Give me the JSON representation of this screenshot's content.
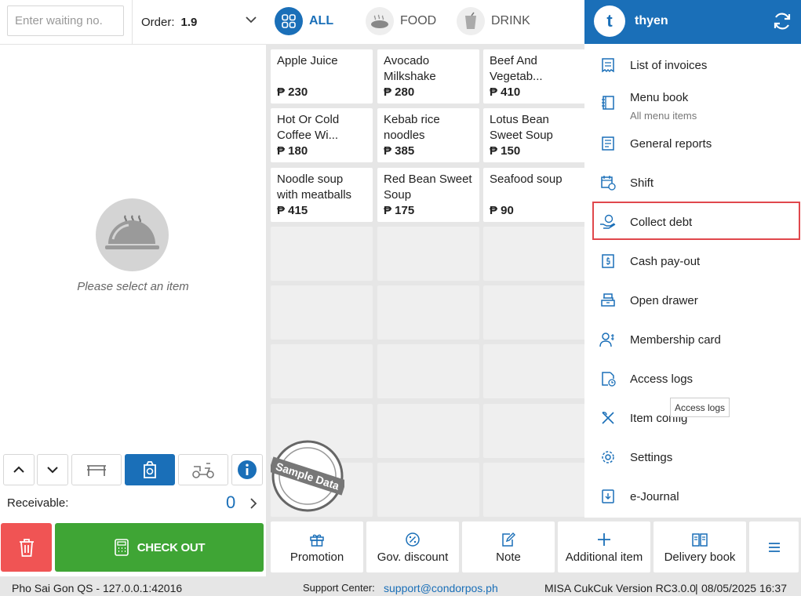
{
  "order_panel": {
    "waiting_placeholder": "Enter waiting no.",
    "order_label": "Order:",
    "order_number": "1.9",
    "empty_message": "Please select an item",
    "receivable_label": "Receivable:",
    "receivable_value": "0",
    "checkout_label": "CHECK OUT"
  },
  "categories": [
    {
      "label": "ALL",
      "icon": "grid-icon",
      "active": true
    },
    {
      "label": "FOOD",
      "icon": "food-icon",
      "active": false
    },
    {
      "label": "DRINK",
      "icon": "drink-icon",
      "active": false
    }
  ],
  "items": [
    {
      "name": "Apple Juice",
      "price": "₱ 230"
    },
    {
      "name": "Avocado Milkshake",
      "price": "₱ 280"
    },
    {
      "name": "Beef And Vegetab...",
      "price": "₱ 410"
    },
    {
      "name": "Hot Or Cold Coffee Wi...",
      "price": "₱ 180"
    },
    {
      "name": "Kebab rice noodles",
      "price": "₱ 385"
    },
    {
      "name": "Lotus Bean Sweet Soup",
      "price": "₱ 150"
    },
    {
      "name": "Noodle soup with meatballs",
      "price": "₱ 415"
    },
    {
      "name": "Red Bean Sweet Soup",
      "price": "₱ 175"
    },
    {
      "name": "Seafood soup",
      "price": "₱ 90"
    }
  ],
  "stamp_text": "Sample Data",
  "bottom_buttons": {
    "promotion": "Promotion",
    "gov_discount": "Gov. discount",
    "note": "Note",
    "additional_item": "Additional item",
    "delivery_book": "Delivery book"
  },
  "user": {
    "initial": "t",
    "name": "thyen"
  },
  "menu": [
    {
      "label": "List of invoices",
      "icon": "invoice-icon"
    },
    {
      "label": "Menu book",
      "sub": "All menu items",
      "icon": "menu-book-icon"
    },
    {
      "label": "General reports",
      "icon": "report-icon"
    },
    {
      "label": "Shift",
      "icon": "calendar-clock-icon"
    },
    {
      "label": "Collect debt",
      "icon": "hand-coin-icon",
      "highlighted": true
    },
    {
      "label": "Cash pay-out",
      "icon": "cash-icon"
    },
    {
      "label": "Open drawer",
      "icon": "drawer-icon"
    },
    {
      "label": "Membership card",
      "icon": "member-icon"
    },
    {
      "label": "Access logs",
      "icon": "log-icon"
    },
    {
      "label": "Item config",
      "icon": "utensils-icon"
    },
    {
      "label": "Settings",
      "icon": "gear-icon"
    },
    {
      "label": "e-Journal",
      "icon": "journal-icon"
    }
  ],
  "tooltip": "Access logs",
  "status": {
    "store": "Pho Sai Gon QS - 127.0.0.1:42016",
    "support_label": "Support Center:",
    "support_email": "support@condorpos.ph",
    "version": "MISA CukCuk Version RC3.0.0",
    "datetime": "08/05/2025 16:37"
  },
  "colors": {
    "primary": "#1a6fb8",
    "checkout": "#3fa535",
    "delete": "#f05454",
    "highlight": "#e0474c"
  }
}
